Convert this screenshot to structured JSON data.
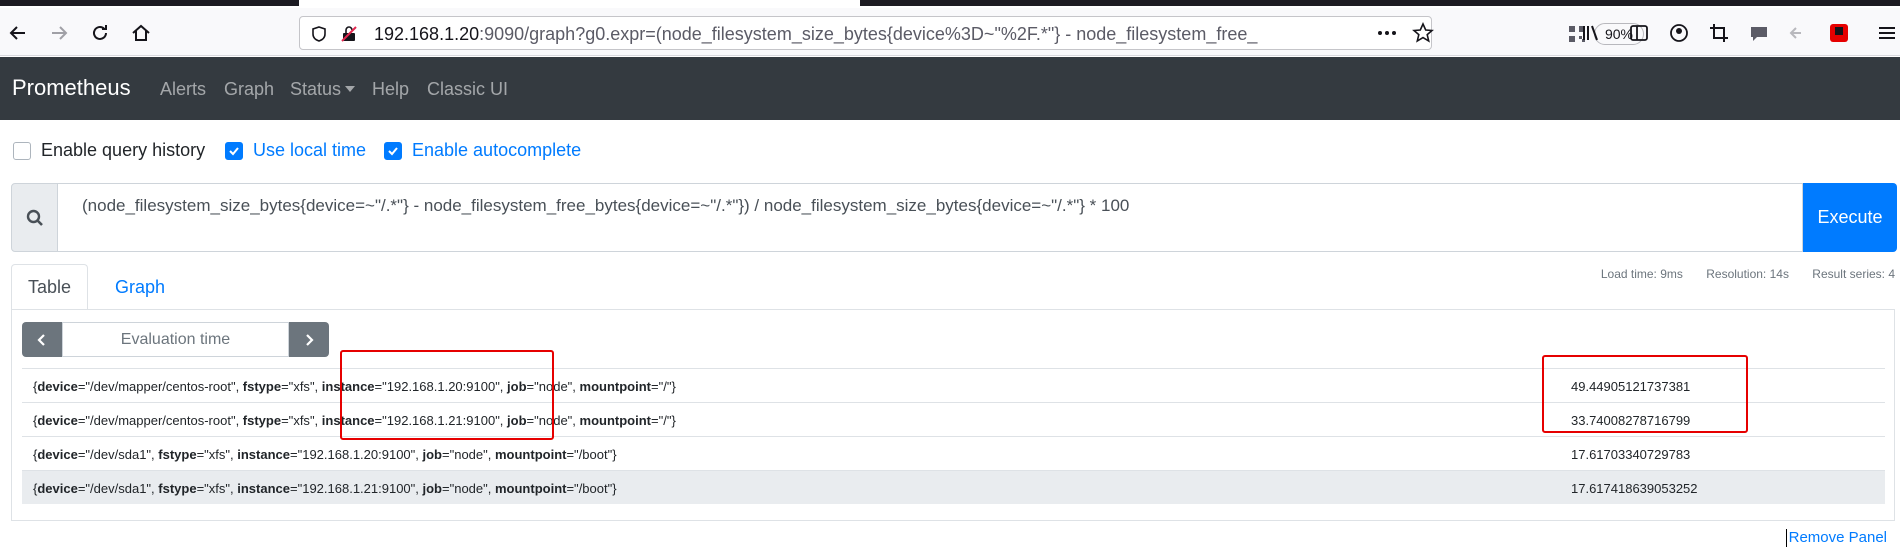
{
  "browser": {
    "url_prefix": "192.168.1.20",
    "url_rest": ":9090/graph?g0.expr=(node_filesystem_size_bytes{device%3D~\"%2F.*\"} - node_filesystem_free_",
    "zoom": "90%"
  },
  "navbar": {
    "brand": "Prometheus",
    "links": [
      "Alerts",
      "Graph",
      "Status",
      "Help",
      "Classic UI"
    ]
  },
  "options": {
    "query_history": "Enable query history",
    "local_time": "Use local time",
    "autocomplete": "Enable autocomplete"
  },
  "query": {
    "expression": "(node_filesystem_size_bytes{device=~\"/.*\"} - node_filesystem_free_bytes{device=~\"/.*\"}) / node_filesystem_size_bytes{device=~\"/.*\"} * 100",
    "execute_label": "Execute"
  },
  "tabs": {
    "table": "Table",
    "graph": "Graph"
  },
  "stats": {
    "load_time": "Load time: 9ms",
    "resolution": "Resolution: 14s",
    "result_series": "Result series: 4"
  },
  "eval_time_placeholder": "Evaluation time",
  "results": [
    {
      "device": "/dev/mapper/centos-root",
      "fstype": "xfs",
      "instance": "192.168.1.20:9100",
      "job": "node",
      "mountpoint": "/",
      "value": "49.44905121737381"
    },
    {
      "device": "/dev/mapper/centos-root",
      "fstype": "xfs",
      "instance": "192.168.1.21:9100",
      "job": "node",
      "mountpoint": "/",
      "value": "33.74008278716799"
    },
    {
      "device": "/dev/sda1",
      "fstype": "xfs",
      "instance": "192.168.1.20:9100",
      "job": "node",
      "mountpoint": "/boot",
      "value": "17.61703340729783"
    },
    {
      "device": "/dev/sda1",
      "fstype": "xfs",
      "instance": "192.168.1.21:9100",
      "job": "node",
      "mountpoint": "/boot",
      "value": "17.617418639053252"
    }
  ],
  "remove_panel": "Remove Panel",
  "colors": {
    "navbar": "#343a40",
    "primary": "#007bff",
    "annotation": "#e60000"
  }
}
